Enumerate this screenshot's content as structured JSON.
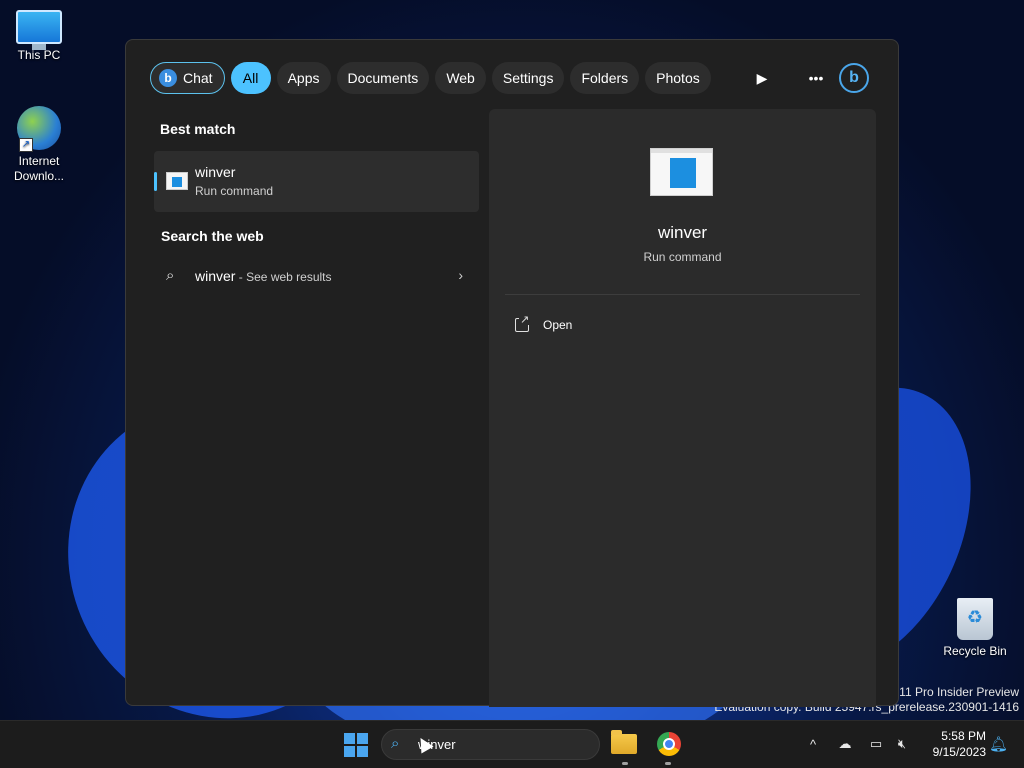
{
  "desktop": {
    "icons": [
      {
        "label": "This PC"
      },
      {
        "label": "Internet Downlo..."
      },
      {
        "label": "Recycle Bin"
      }
    ],
    "watermark_line1": "s 11 Pro Insider Preview",
    "watermark_line2": "Evaluation copy. Build 25947.rs_prerelease.230901-1416"
  },
  "search_panel": {
    "filters": [
      {
        "label": "Chat"
      },
      {
        "label": "All",
        "selected": true
      },
      {
        "label": "Apps"
      },
      {
        "label": "Documents"
      },
      {
        "label": "Web"
      },
      {
        "label": "Settings"
      },
      {
        "label": "Folders"
      },
      {
        "label": "Photos"
      }
    ],
    "best_match": {
      "heading": "Best match",
      "name": "winver",
      "type": "Run command"
    },
    "web": {
      "heading": "Search the web",
      "query": "winver",
      "suffix": " - See web results"
    },
    "details": {
      "name": "winver",
      "type": "Run command",
      "actions": [
        {
          "label": "Open"
        }
      ]
    }
  },
  "taskbar": {
    "search_value": "winver",
    "clock_time": "5:58 PM",
    "clock_date": "9/15/2023"
  },
  "colors": {
    "accent": "#4cc2ff",
    "panel_bg": "#202020",
    "details_bg": "#2b2b2b"
  }
}
